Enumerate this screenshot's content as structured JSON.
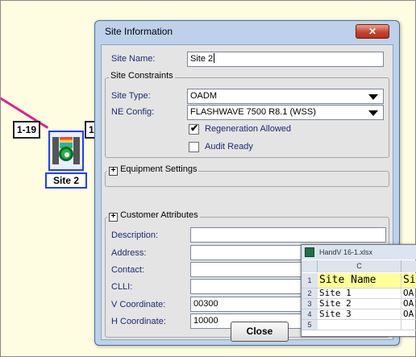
{
  "canvas": {
    "ports": {
      "left": "1-19",
      "right": "1"
    },
    "node_label": "Site 2",
    "link_color": "#e0218a",
    "highlight_color": "#1e3cff"
  },
  "dialog": {
    "title": "Site Information",
    "close_icon": "close-x",
    "site_name_label": "Site Name:",
    "site_name_value": "Site 2",
    "constraints": {
      "title": "Site Constraints",
      "site_type_label": "Site Type:",
      "site_type_value": "OADM",
      "ne_config_label": "NE Config:",
      "ne_config_value": "FLASHWAVE 7500 R8.1 (WSS)",
      "regeneration_label": "Regeneration Allowed",
      "regeneration_checked": true,
      "audit_label": "Audit Ready",
      "audit_checked": false
    },
    "equipment": {
      "title": "Equipment Settings",
      "expander": "+"
    },
    "customer": {
      "title": "Customer Attributes",
      "expander": "+",
      "description_label": "Description:",
      "description_value": "",
      "address_label": "Address:",
      "address_value": "",
      "contact_label": "Contact:",
      "contact_value": "",
      "clli_label": "CLLI:",
      "clli_value": "",
      "v_coord_label": "V Coordinate:",
      "v_coord_value": "00300",
      "h_coord_label": "H Coordinate:",
      "h_coord_value": "10000"
    },
    "close_button": "Close"
  },
  "excel": {
    "filename": "HandV 16-1.xlsx",
    "column_header": "C",
    "rows": [
      {
        "num": "1",
        "c": "Site Name",
        "d": "Si"
      },
      {
        "num": "2",
        "c": "Site 1",
        "d": "OA"
      },
      {
        "num": "3",
        "c": "Site 2",
        "d": "OA"
      },
      {
        "num": "4",
        "c": "Site 3",
        "d": "OA"
      },
      {
        "num": "5",
        "c": "",
        "d": ""
      }
    ]
  }
}
